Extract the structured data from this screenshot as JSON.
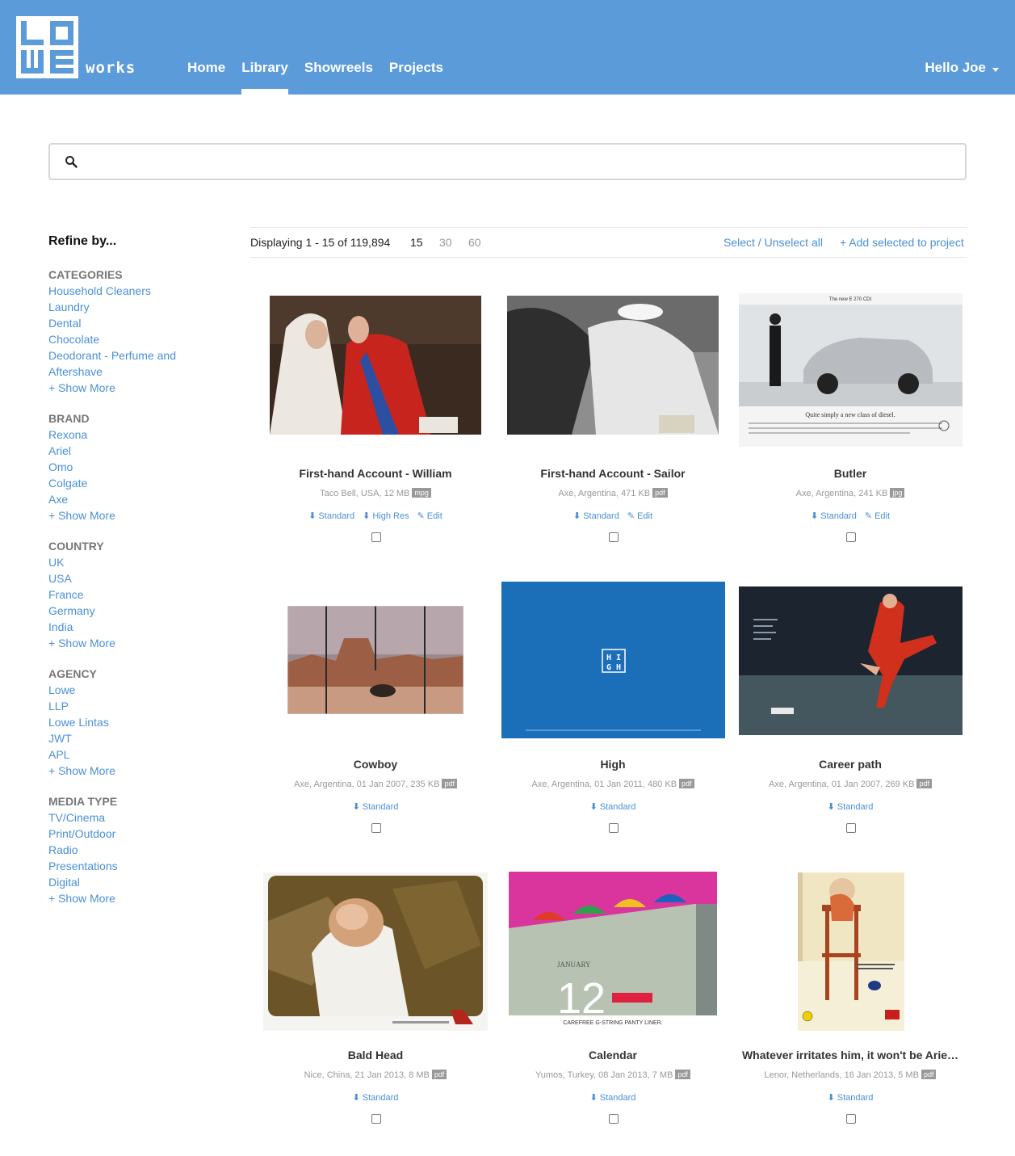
{
  "header": {
    "logo_letters": [
      "L",
      "O",
      "W",
      "E"
    ],
    "logo_word": "works",
    "nav": [
      {
        "label": "Home",
        "active": false
      },
      {
        "label": "Library",
        "active": true
      },
      {
        "label": "Showreels",
        "active": false
      },
      {
        "label": "Projects",
        "active": false
      }
    ],
    "user_greeting": "Hello Joe",
    "brand_color": "#5b9bd9"
  },
  "search": {
    "placeholder": "",
    "value": ""
  },
  "sidebar": {
    "title": "Refine by...",
    "facets": [
      {
        "heading": "CATEGORIES",
        "items": [
          "Household Cleaners",
          "Laundry",
          "Dental",
          "Chocolate",
          "Deodorant - Perfume and Aftershave"
        ],
        "more": "+ Show More"
      },
      {
        "heading": "BRAND",
        "items": [
          "Rexona",
          "Ariel",
          "Omo",
          "Colgate",
          "Axe"
        ],
        "more": "+ Show More"
      },
      {
        "heading": "COUNTRY",
        "items": [
          "UK",
          "USA",
          "France",
          "Germany",
          "India"
        ],
        "more": "+ Show More"
      },
      {
        "heading": "AGENCY",
        "items": [
          "Lowe",
          "LLP",
          "Lowe Lintas",
          "JWT",
          "APL"
        ],
        "more": "+ Show More"
      },
      {
        "heading": "MEDIA TYPE",
        "items": [
          "TV/Cinema",
          "Print/Outdoor",
          "Radio",
          "Presentations",
          "Digital"
        ],
        "more": "+ Show More"
      }
    ]
  },
  "toolbar": {
    "displaying": "Displaying 1 - 15 of 119,894",
    "per_page": [
      "15",
      "30",
      "60"
    ],
    "per_page_selected": "15",
    "select_all": "Select / Unselect all",
    "add_to_project": "+ Add selected to project"
  },
  "results": [
    {
      "title": "First-hand Account - William",
      "meta": "Taco Bell, USA, 12 MB",
      "format": "mpg",
      "links": [
        "Standard",
        "High Res",
        "Edit"
      ]
    },
    {
      "title": "First-hand Account - Sailor",
      "meta": "Axe, Argentina, 471 KB",
      "format": "pdf",
      "links": [
        "Standard",
        "Edit"
      ]
    },
    {
      "title": "Butler",
      "meta": "Axe, Argentina, 241 KB",
      "format": "jpg",
      "links": [
        "Standard",
        "Edit"
      ]
    },
    {
      "title": "Cowboy",
      "meta": "Axe, Argentina, 01 Jan 2007, 235 KB",
      "format": "pdf",
      "links": [
        "Standard"
      ]
    },
    {
      "title": "High",
      "meta": "Axe, Argentina, 01 Jan 2011, 480 KB",
      "format": "pdf",
      "links": [
        "Standard"
      ]
    },
    {
      "title": "Career path",
      "meta": "Axe, Argentina, 01 Jan 2007, 269 KB",
      "format": "pdf",
      "links": [
        "Standard"
      ]
    },
    {
      "title": "Bald Head",
      "meta": "Nice, China, 21 Jan 2013, 8 MB",
      "format": "pdf",
      "links": [
        "Standard"
      ]
    },
    {
      "title": "Calendar",
      "meta": "Yumos, Turkey, 08 Jan 2013, 7 MB",
      "format": "pdf",
      "links": [
        "Standard"
      ]
    },
    {
      "title": "Whatever irritates him, it won't be Arie…",
      "meta": "Lenor, Netherlands, 16 Jan 2013, 5 MB",
      "format": "pdf",
      "links": [
        "Standard"
      ]
    }
  ],
  "thumb_text": {
    "butler_headline": "The new E 270 CDI",
    "butler_tagline": "Quite simply a new class of diesel.",
    "high_logo": [
      "H",
      "I",
      "G",
      "H"
    ],
    "calendar_month": "JANUARY",
    "calendar_day": "12",
    "calendar_caption": "CAREFREE G-STRING PANTY LINER."
  }
}
